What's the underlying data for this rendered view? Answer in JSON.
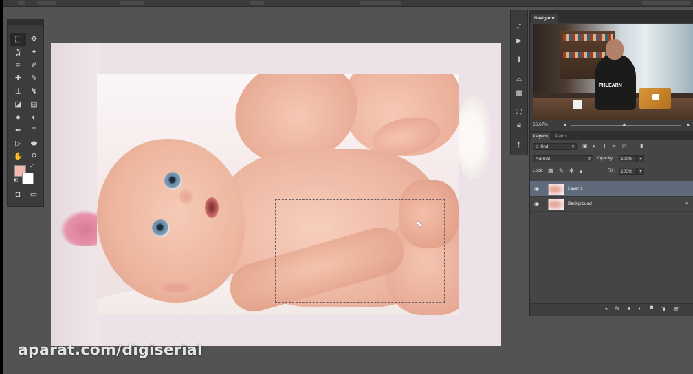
{
  "app": {
    "accent_color": "#5f6a7a"
  },
  "tools": {
    "items": [
      {
        "name": "rectangular-marquee-tool-icon",
        "glyph": "⬚"
      },
      {
        "name": "move-tool-icon",
        "glyph": "✥"
      },
      {
        "name": "lasso-tool-icon",
        "glyph": "ຽ"
      },
      {
        "name": "magic-wand-tool-icon",
        "glyph": "✦"
      },
      {
        "name": "crop-tool-icon",
        "glyph": "⌗"
      },
      {
        "name": "eyedropper-tool-icon",
        "glyph": "✐"
      },
      {
        "name": "spot-healing-brush-icon",
        "glyph": "✚"
      },
      {
        "name": "brush-tool-icon",
        "glyph": "✎"
      },
      {
        "name": "clone-stamp-tool-icon",
        "glyph": "⊥"
      },
      {
        "name": "history-brush-icon",
        "glyph": "↯"
      },
      {
        "name": "eraser-tool-icon",
        "glyph": "◪"
      },
      {
        "name": "gradient-tool-icon",
        "glyph": "▤"
      },
      {
        "name": "blur-tool-icon",
        "glyph": "●"
      },
      {
        "name": "dodge-tool-icon",
        "glyph": "◐"
      },
      {
        "name": "pen-tool-icon",
        "glyph": "✒"
      },
      {
        "name": "type-tool-icon",
        "glyph": "T"
      },
      {
        "name": "path-selection-tool-icon",
        "glyph": "▷"
      },
      {
        "name": "ellipse-tool-icon",
        "glyph": "⬬"
      },
      {
        "name": "hand-tool-icon",
        "glyph": "✋"
      },
      {
        "name": "zoom-tool-icon",
        "glyph": "⚲"
      }
    ],
    "foreground_color": "#f4b9ae",
    "background_color": "#ffffff",
    "quick-mask-icon": "◘",
    "screen-mode-icon": "▭"
  },
  "watermark": "aparat.com/digiserial",
  "navigator": {
    "tab": "Navigator",
    "zoom": "66.67%",
    "shirt_text": "PHLEARN"
  },
  "layers": {
    "tabs": [
      "Layers",
      "Paths"
    ],
    "filter": "ρ Kind",
    "blend_mode": "Normal",
    "opacity_label": "Opacity:",
    "opacity_value": "100%",
    "lock_label": "Lock:",
    "fill_label": "Fill:",
    "fill_value": "100%",
    "items": [
      {
        "name": "Layer 1",
        "selected": true
      },
      {
        "name": "Background",
        "selected": false
      }
    ]
  }
}
